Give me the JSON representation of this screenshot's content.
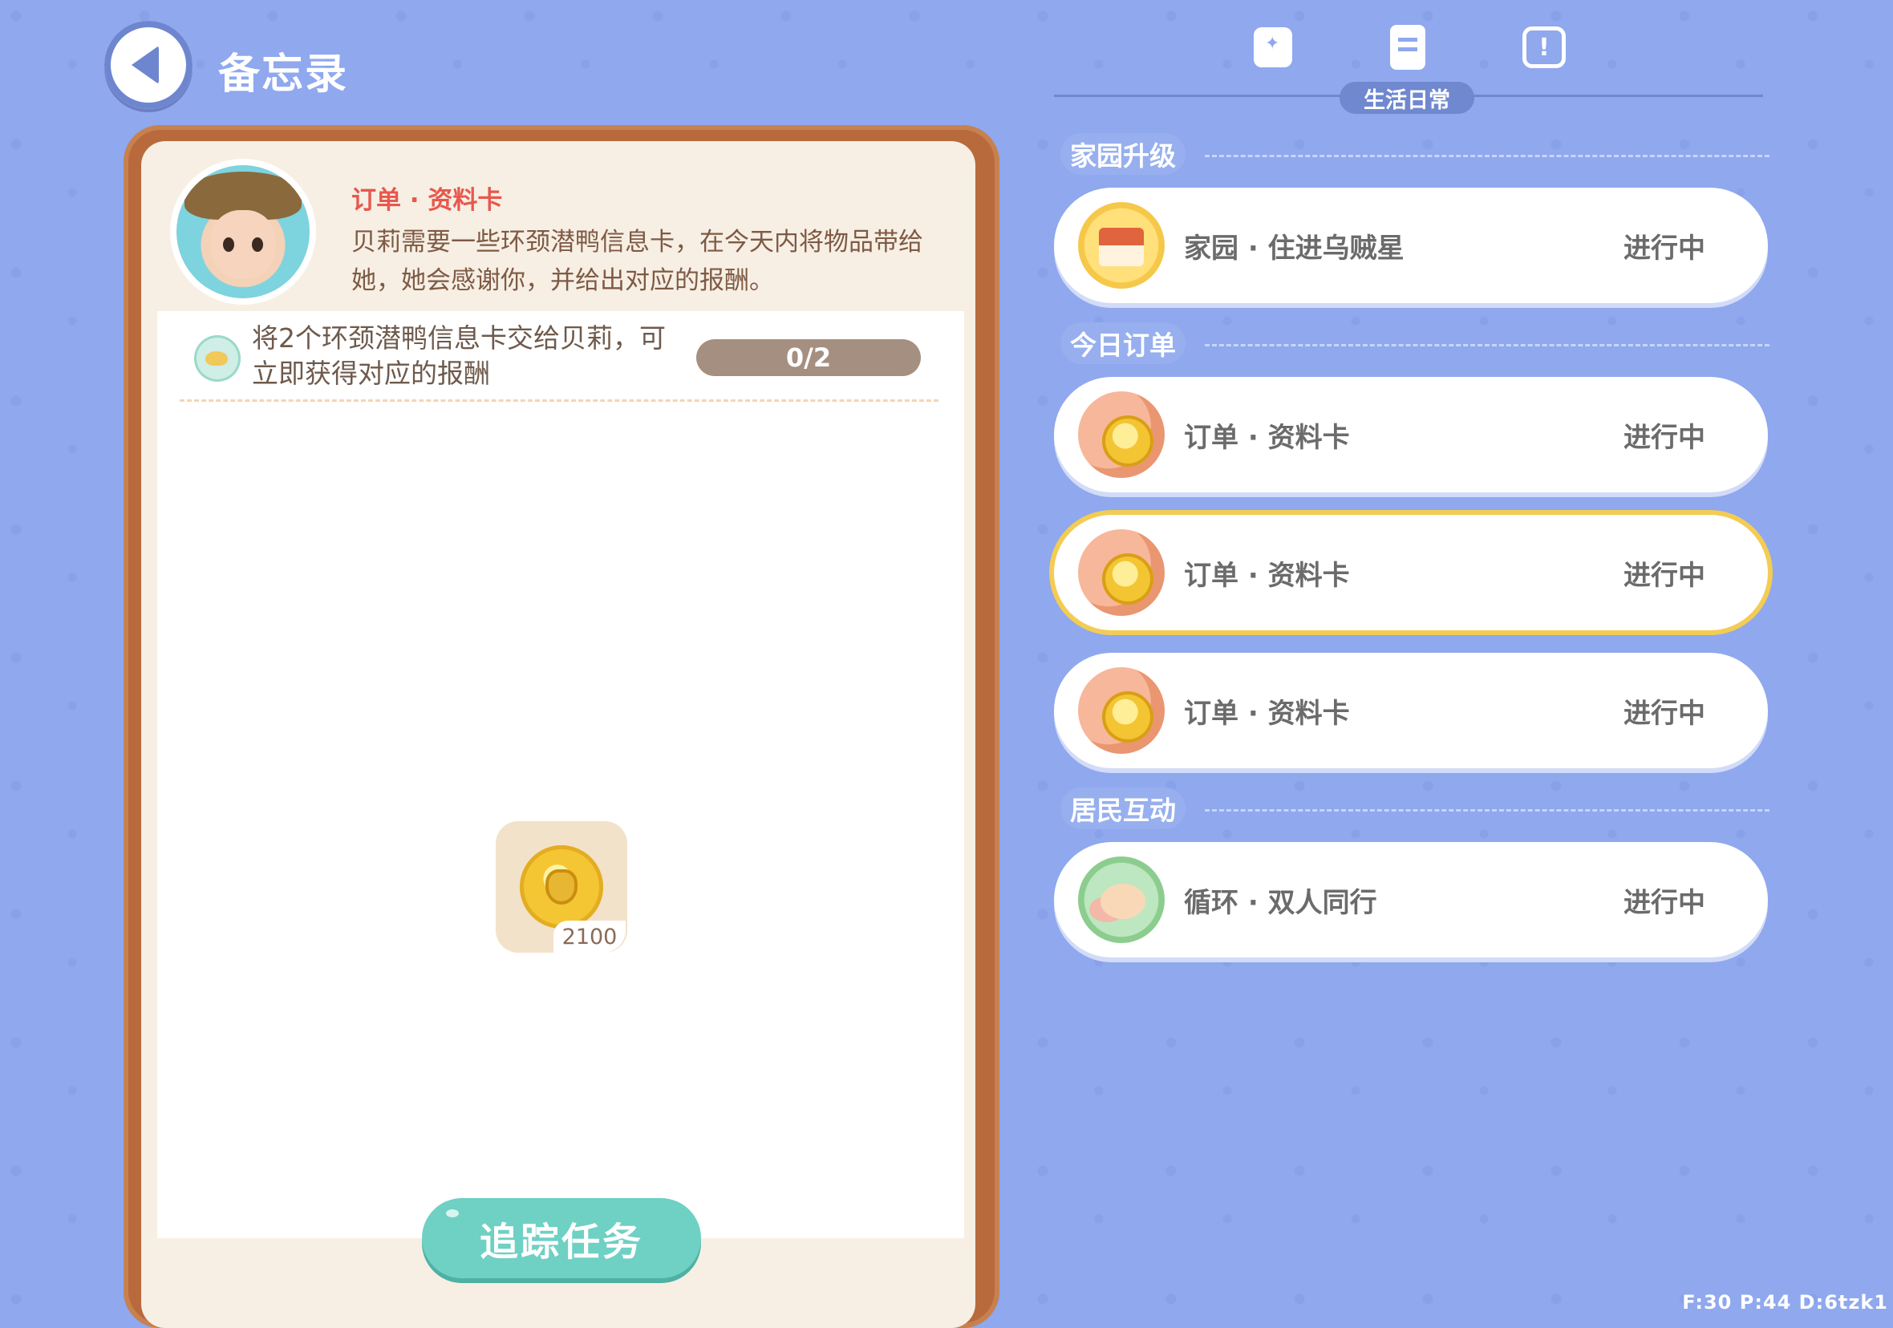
{
  "header": {
    "title": "备忘录"
  },
  "tabs": {
    "active_label": "生活日常"
  },
  "detail": {
    "order_title": "订单 · 资料卡",
    "description": "贝莉需要一些环颈潜鸭信息卡，在今天内将物品带给她，她会感谢你，并给出对应的报酬。",
    "task_text": "将2个环颈潜鸭信息卡交给贝莉，可立即获得对应的报酬",
    "progress_text": "0/2",
    "progress_fraction": 0,
    "reward_count": "2100",
    "track_button": "追踪任务"
  },
  "sections": {
    "home": {
      "label": "家园升级",
      "items": [
        {
          "label": "家园 · 住进乌贼星",
          "status": "进行中",
          "icon": "house-icon"
        }
      ]
    },
    "orders": {
      "label": "今日订单",
      "items": [
        {
          "label": "订单 · 资料卡",
          "status": "进行中",
          "icon": "coin-icon"
        },
        {
          "label": "订单 · 资料卡",
          "status": "进行中",
          "icon": "coin-icon",
          "selected": true
        },
        {
          "label": "订单 · 资料卡",
          "status": "进行中",
          "icon": "coin-icon"
        }
      ]
    },
    "residents": {
      "label": "居民互动",
      "items": [
        {
          "label": "循环 · 双人同行",
          "status": "进行中",
          "icon": "people-icon"
        }
      ]
    }
  },
  "footer": {
    "stats": "F:30 P:44 D:6tzk1"
  },
  "colors": {
    "background": "#8fa8ee",
    "accent": "#6fd0c4",
    "selected_border": "#f3cc53",
    "order_title": "#e7584e"
  }
}
